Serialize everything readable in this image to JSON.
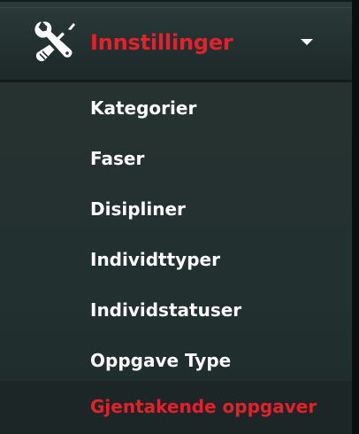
{
  "header": {
    "label": "Innstillinger",
    "icon": "tools-icon",
    "caret_icon": "caret-down-icon",
    "accent_color": "#e4212b"
  },
  "submenu": {
    "items": [
      {
        "label": "Kategorier"
      },
      {
        "label": "Faser"
      },
      {
        "label": "Disipliner"
      },
      {
        "label": "Individttyper"
      },
      {
        "label": "Individstatuser"
      },
      {
        "label": "Oppgave Type"
      },
      {
        "label": "Gjentakende oppgaver",
        "active": true
      }
    ],
    "text_color": "#ffffff",
    "active_color": "#e4212b"
  }
}
